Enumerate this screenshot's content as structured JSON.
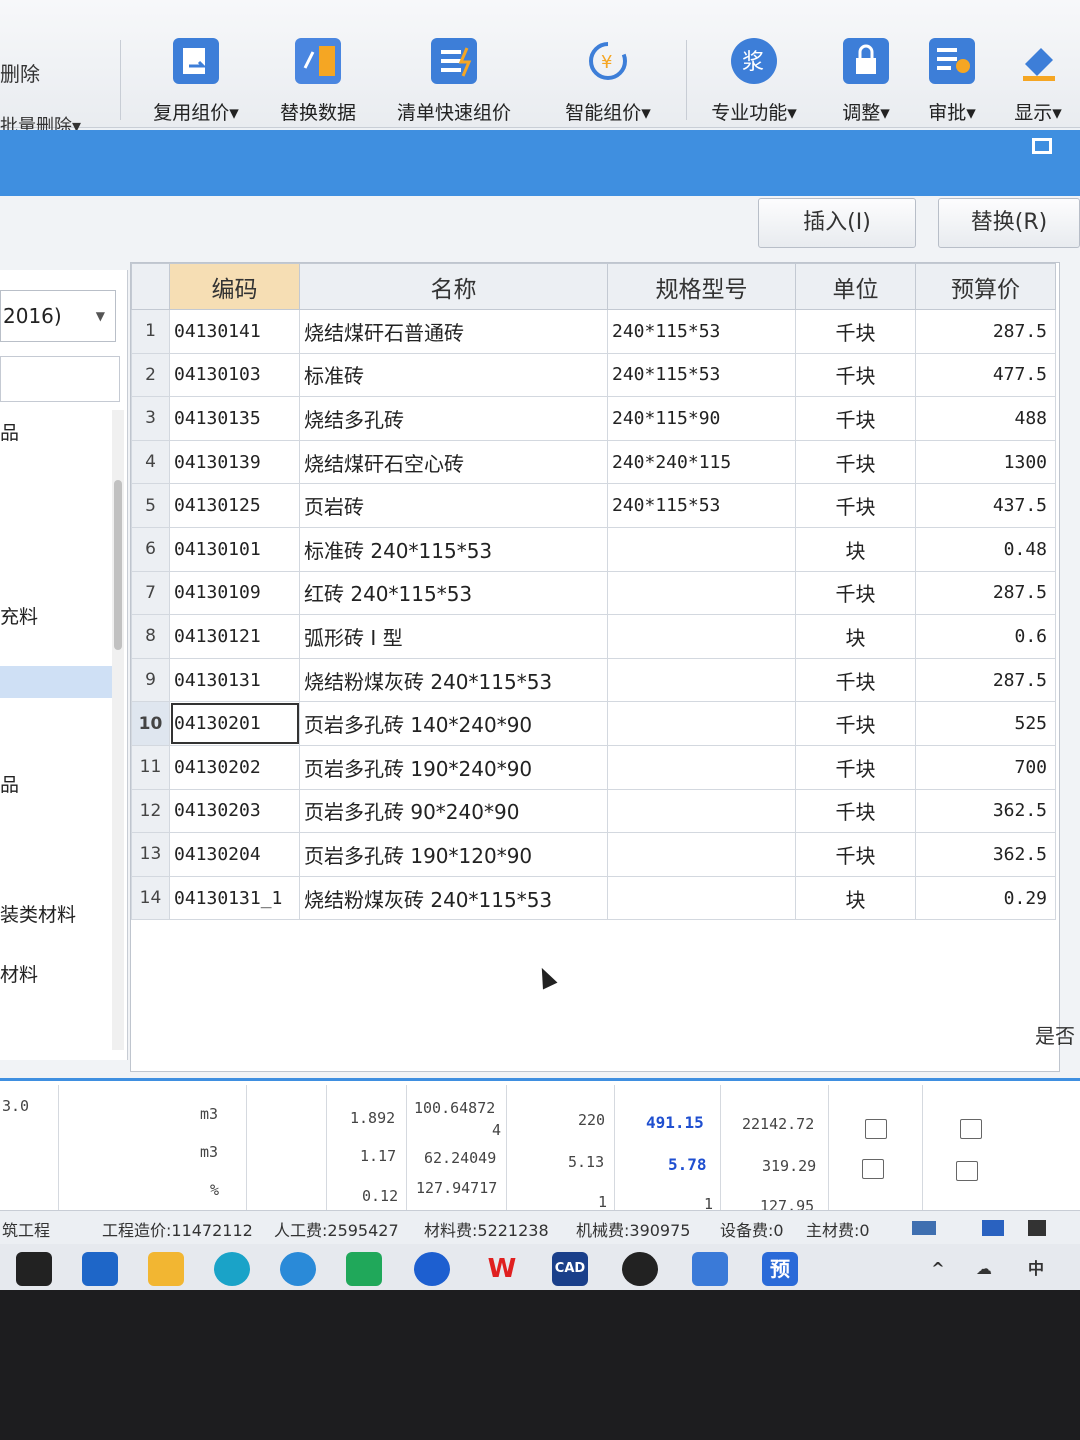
{
  "ribbon": {
    "left_label_1": "删除",
    "left_label_2": "批量删除▾",
    "buttons": [
      {
        "label": "复用组价▾",
        "icon": "reuse-pricing-icon"
      },
      {
        "label": "替换数据",
        "icon": "replace-data-icon"
      },
      {
        "label": "清单快速组价",
        "icon": "quick-pricing-icon"
      },
      {
        "label": "智能组价▾",
        "icon": "smart-pricing-icon"
      },
      {
        "label": "专业功能▾",
        "icon": "professional-icon"
      },
      {
        "label": "调整▾",
        "icon": "lock-icon"
      },
      {
        "label": "审批▾",
        "icon": "approve-icon"
      },
      {
        "label": "显示▾",
        "icon": "display-icon"
      }
    ]
  },
  "dialog": {
    "insert_label": "插入(I)",
    "replace_label": "替换(R)"
  },
  "left_panel": {
    "library_select": "2016)",
    "tree_items": [
      "品",
      "充料",
      "品",
      "装类材料",
      "材料"
    ]
  },
  "table": {
    "columns": [
      "编码",
      "名称",
      "规格型号",
      "单位",
      "预算价"
    ],
    "rows": [
      {
        "no": "1",
        "code": "04130141",
        "name": "烧结煤矸石普通砖",
        "spec": "240*115*53",
        "unit": "千块",
        "price": "287.5"
      },
      {
        "no": "2",
        "code": "04130103",
        "name": "标准砖",
        "spec": "240*115*53",
        "unit": "千块",
        "price": "477.5"
      },
      {
        "no": "3",
        "code": "04130135",
        "name": "烧结多孔砖",
        "spec": "240*115*90",
        "unit": "千块",
        "price": "488"
      },
      {
        "no": "4",
        "code": "04130139",
        "name": "烧结煤矸石空心砖",
        "spec": "240*240*115",
        "unit": "千块",
        "price": "1300"
      },
      {
        "no": "5",
        "code": "04130125",
        "name": "页岩砖",
        "spec": "240*115*53",
        "unit": "千块",
        "price": "437.5"
      },
      {
        "no": "6",
        "code": "04130101",
        "name": "标准砖 240*115*53",
        "spec": "",
        "unit": "块",
        "price": "0.48"
      },
      {
        "no": "7",
        "code": "04130109",
        "name": "红砖 240*115*53",
        "spec": "",
        "unit": "千块",
        "price": "287.5"
      },
      {
        "no": "8",
        "code": "04130121",
        "name": "弧形砖 I 型",
        "spec": "",
        "unit": "块",
        "price": "0.6"
      },
      {
        "no": "9",
        "code": "04130131",
        "name": "烧结粉煤灰砖 240*115*53",
        "spec": "",
        "unit": "千块",
        "price": "287.5"
      },
      {
        "no": "10",
        "code": "04130201",
        "name": "页岩多孔砖 140*240*90",
        "spec": "",
        "unit": "千块",
        "price": "525"
      },
      {
        "no": "11",
        "code": "04130202",
        "name": "页岩多孔砖 190*240*90",
        "spec": "",
        "unit": "千块",
        "price": "700"
      },
      {
        "no": "12",
        "code": "04130203",
        "name": "页岩多孔砖 90*240*90",
        "spec": "",
        "unit": "千块",
        "price": "362.5"
      },
      {
        "no": "13",
        "code": "04130204",
        "name": "页岩多孔砖 190*120*90",
        "spec": "",
        "unit": "千块",
        "price": "362.5"
      },
      {
        "no": "14",
        "code": "04130131_1",
        "name": "烧结粉煤灰砖 240*115*53",
        "spec": "",
        "unit": "块",
        "price": "0.29"
      }
    ]
  },
  "right_peek": "是否",
  "bottom_grid": {
    "row1": {
      "lead": "3.0",
      "unit": "m3",
      "qty": "1.892",
      "val": "100.64872",
      "val2": "4",
      "price": "220",
      "budget": "491.15",
      "total": "22142.72"
    },
    "row2": {
      "unit": "m3",
      "qty": "1.17",
      "val": "62.24049",
      "price": "5.13",
      "budget": "5.78",
      "total": "319.29"
    },
    "row3": {
      "unit": "%",
      "qty": "0.12",
      "val": "127.94717",
      "price": "1",
      "budget": "1",
      "total": "127.95"
    }
  },
  "status": {
    "project": "筑工程",
    "cost": "工程造价:11472112",
    "labor": "人工费:2595427",
    "material": "材料费:5221238",
    "machine": "机械费:390975",
    "equipment": "设备费:0",
    "main_material": "主材费:0"
  },
  "taskbar": {
    "icons": [
      "start-icon",
      "store-icon",
      "folder-icon",
      "edge-icon",
      "ie-icon",
      "mail-icon",
      "lenovo-icon",
      "wps-icon",
      "cad-icon",
      "qq-icon",
      "glodon-icon",
      "budget-app-icon"
    ],
    "cad_label": "CAD",
    "wps_label": "W",
    "budget_label": "预"
  },
  "colors": {
    "accent": "#3f8fe0",
    "header_sorted": "#f6deb4",
    "blue_value": "#1f4fd0"
  }
}
